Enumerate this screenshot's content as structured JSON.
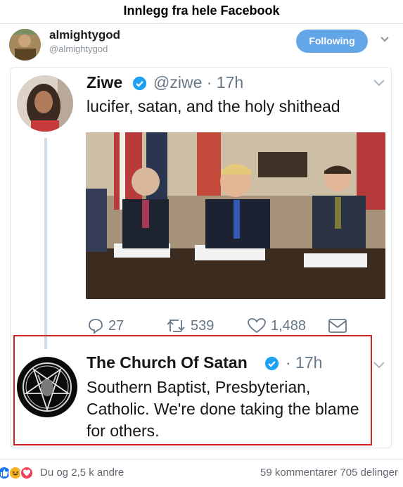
{
  "header": {
    "title": "Innlegg fra hele Facebook"
  },
  "account": {
    "name": "almightygod",
    "handle": "@almightygod",
    "follow_label": "Following"
  },
  "tweet1": {
    "name": "Ziwe",
    "handle_time": "@ziwe · 17h",
    "text": "lucifer, satan, and the holy shithead",
    "replies": "27",
    "retweets": "539",
    "likes": "1,488"
  },
  "tweet2": {
    "name": "The Church Of Satan",
    "time": "· 17h",
    "text": "Southern Baptist, Presbyterian, Catholic. We're done taking the blame for others."
  },
  "footer": {
    "reactions_text": "Du og 2,5 k andre",
    "stats_text": "59 kommentarer  705 delinger"
  },
  "colors": {
    "follow_button": "#62a6e8",
    "verified_badge": "#1da1f2",
    "highlight_box": "#d0231f",
    "like_reaction": "#1877f2",
    "love_reaction": "#f33e58",
    "haha_reaction": "#f7b125"
  }
}
